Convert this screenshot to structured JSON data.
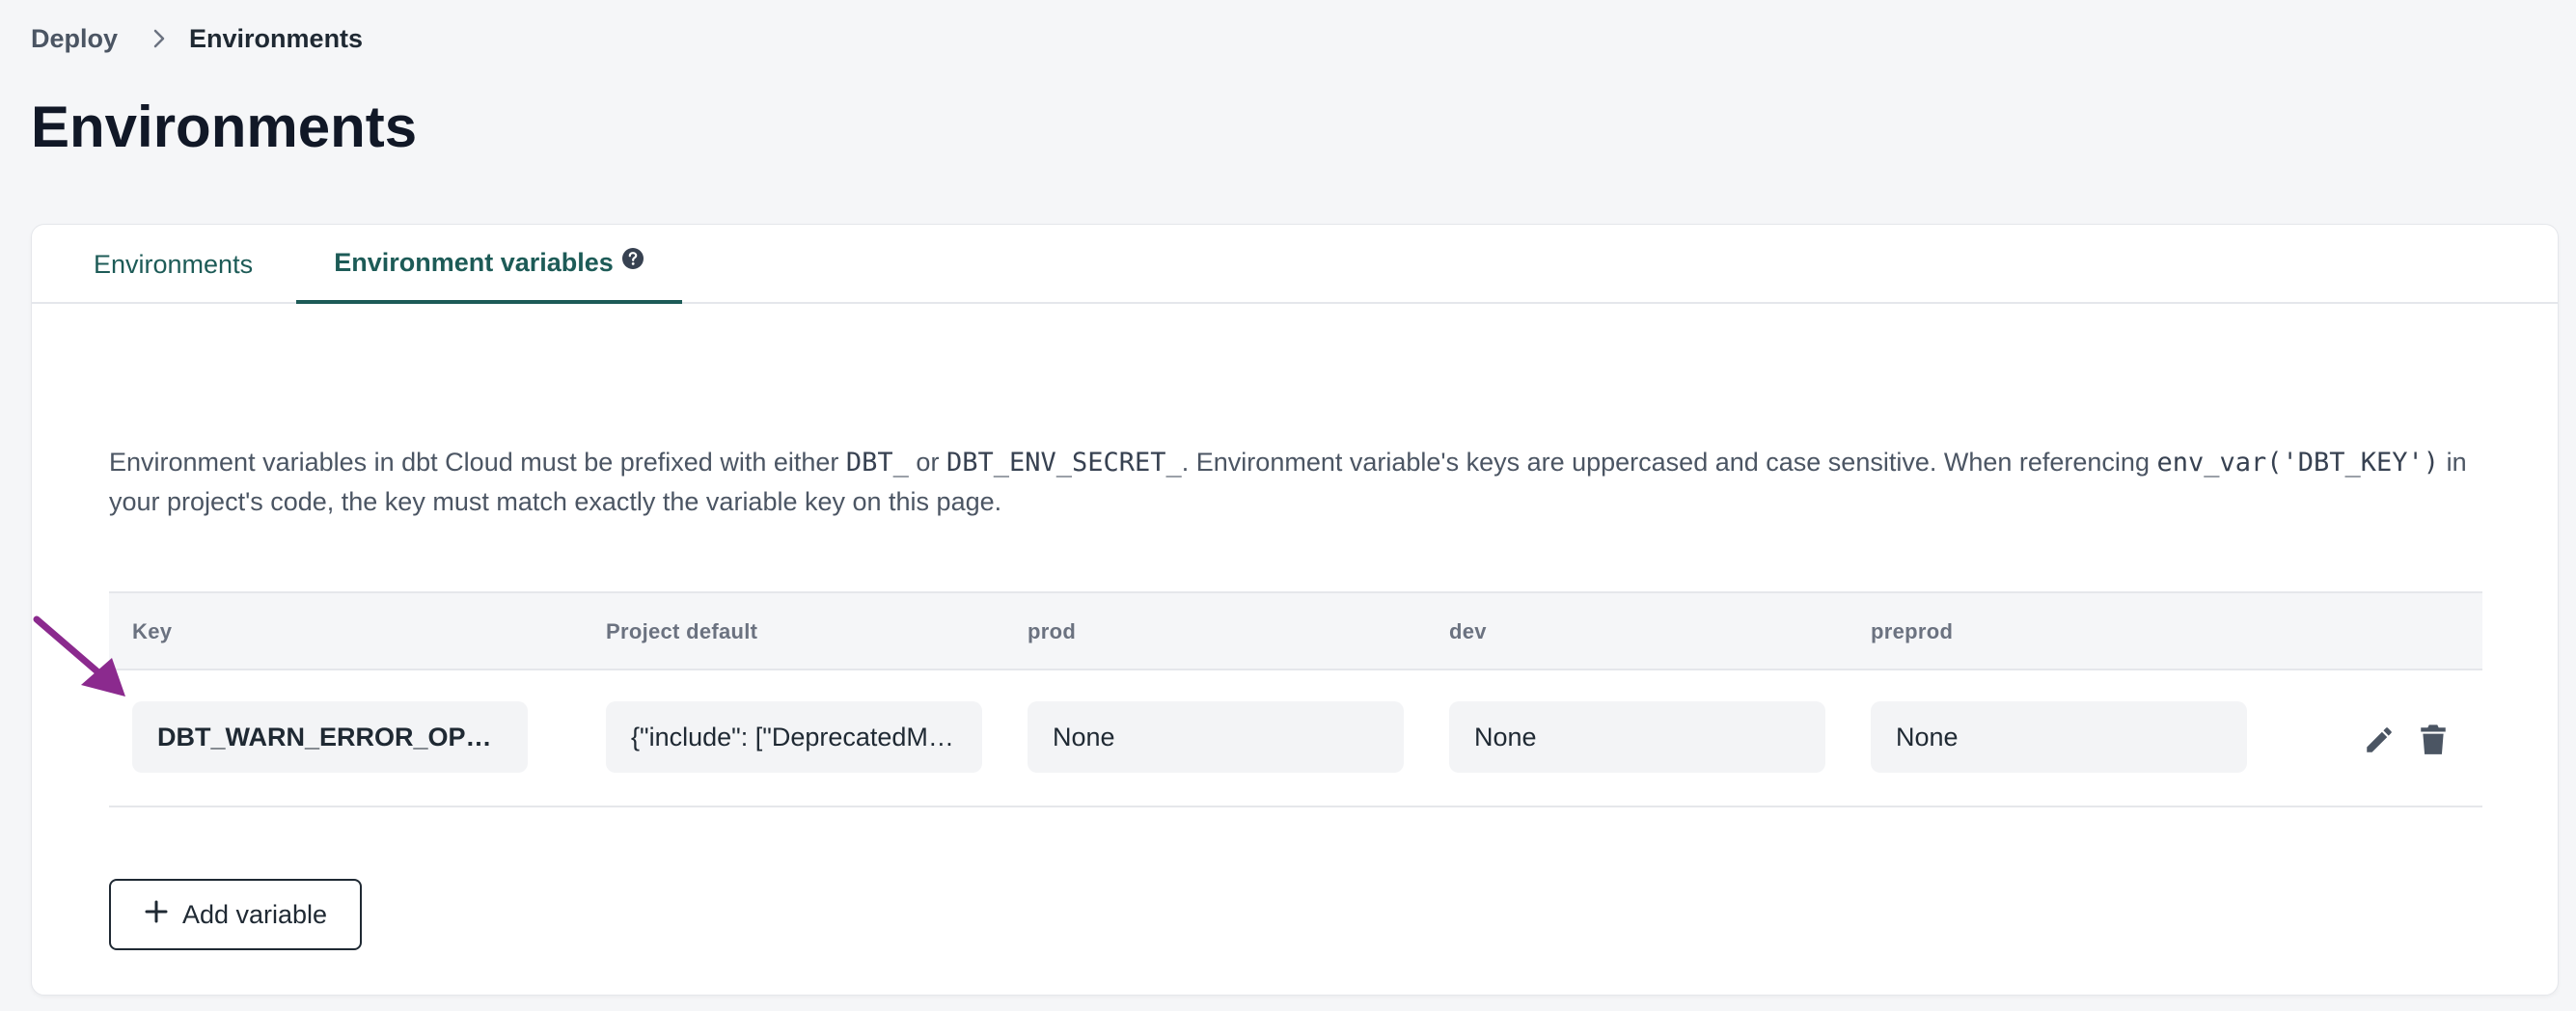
{
  "breadcrumb": {
    "parent": "Deploy",
    "current": "Environments"
  },
  "page": {
    "title": "Environments"
  },
  "tabs": [
    {
      "label": "Environments",
      "active": false
    },
    {
      "label": "Environment variables",
      "active": true
    }
  ],
  "description": {
    "t1": "Environment variables in dbt Cloud must be prefixed with either ",
    "code1": "DBT_",
    "t2": " or ",
    "code2": "DBT_ENV_SECRET_",
    "t3": ". Environment variable's keys are uppercased and case sensitive. When referencing ",
    "code3": "env_var('DBT_KEY')",
    "t4": " in your project's code, the key must match exactly the variable key on this page."
  },
  "table": {
    "columns": [
      "Key",
      "Project default",
      "prod",
      "dev",
      "preprod"
    ],
    "rows": [
      {
        "key": "DBT_WARN_ERROR_OPTIONS",
        "project_default": "{\"include\": [\"DeprecatedM…",
        "prod": "None",
        "dev": "None",
        "preprod": "None"
      }
    ]
  },
  "add_button": {
    "label": "Add variable"
  },
  "colors": {
    "accent": "#1d5b57",
    "annotation_arrow": "#8b2a8e"
  },
  "icons": {
    "separator": "chevron-right-icon",
    "help": "question-circle-icon",
    "edit": "pencil-icon",
    "delete": "trash-icon",
    "add": "plus-icon",
    "annotation": "arrow-annotation-icon"
  }
}
